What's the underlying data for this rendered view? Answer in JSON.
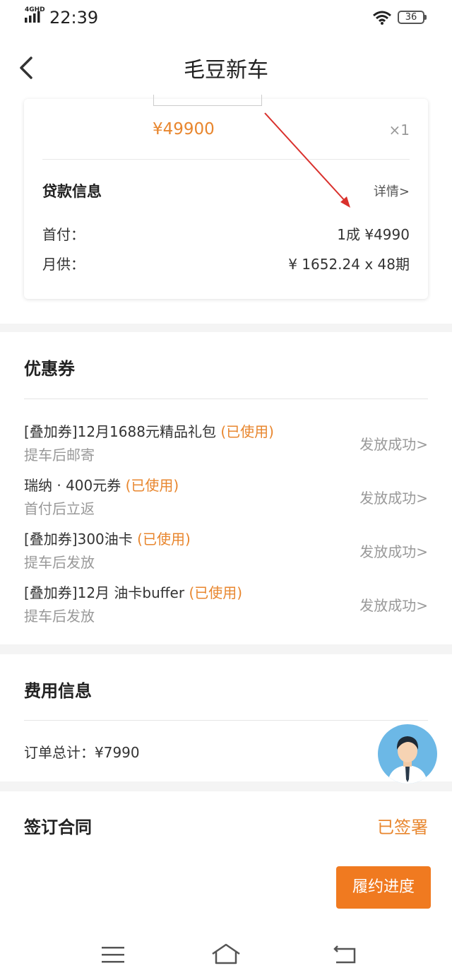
{
  "status_bar": {
    "network": "4GHD",
    "time": "22:39",
    "battery": "36"
  },
  "header": {
    "title": "毛豆新车"
  },
  "order": {
    "price": "¥49900",
    "quantity": "×1"
  },
  "loan": {
    "title": "贷款信息",
    "detail_link": "详情>",
    "rows": [
      {
        "label": "首付：",
        "value": "1成 ¥4990"
      },
      {
        "label": "月供：",
        "value": "¥ 1652.24 x 48期"
      }
    ]
  },
  "coupons": {
    "title": "优惠券",
    "used_label": "(已使用)",
    "items": [
      {
        "name": "[叠加券]12月1688元精品礼包",
        "sub": "提车后邮寄",
        "status": "发放成功>"
      },
      {
        "name": "瑞纳 · 400元券",
        "sub": "首付后立返",
        "status": "发放成功>"
      },
      {
        "name": "[叠加券]300油卡",
        "sub": "提车后发放",
        "status": "发放成功>"
      },
      {
        "name": "[叠加券]12月 油卡buffer",
        "sub": "提车后发放",
        "status": "发放成功>"
      }
    ]
  },
  "fees": {
    "title": "费用信息",
    "total": "订单总计：¥7990"
  },
  "contract": {
    "title": "签订合同",
    "status": "已签署",
    "progress_button": "履约进度"
  },
  "colors": {
    "accent": "#e8862e",
    "button": "#f07a20",
    "arrow": "#d9302c"
  },
  "icons": {
    "back": "chevron-left-icon",
    "wifi": "wifi-icon",
    "signal": "signal-icon",
    "battery": "battery-icon",
    "avatar": "customer-service-avatar",
    "nav_menu": "menu-icon",
    "nav_home": "home-icon",
    "nav_back": "back-icon"
  }
}
